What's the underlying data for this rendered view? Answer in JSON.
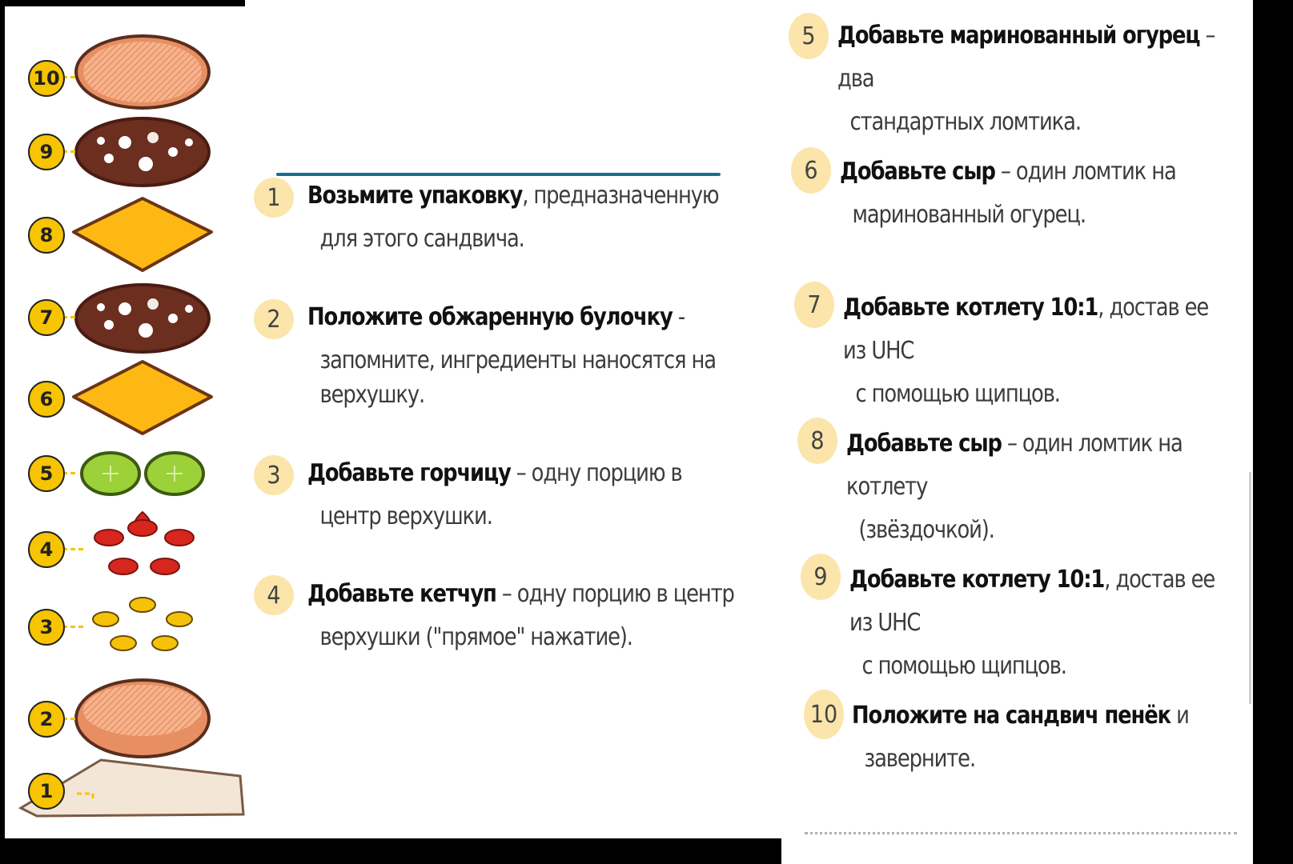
{
  "layers": [
    {
      "n": "10",
      "item": "bun-top"
    },
    {
      "n": "9",
      "item": "patty"
    },
    {
      "n": "8",
      "item": "cheese"
    },
    {
      "n": "7",
      "item": "patty"
    },
    {
      "n": "6",
      "item": "cheese"
    },
    {
      "n": "5",
      "item": "pickles"
    },
    {
      "n": "4",
      "item": "ketchup"
    },
    {
      "n": "3",
      "item": "mustard"
    },
    {
      "n": "2",
      "item": "bun-bottom"
    },
    {
      "n": "1",
      "item": "wrapper"
    }
  ],
  "steps": [
    {
      "num": "1",
      "bold": "Возьмите упаковку",
      "rest_first": ", предназначенную",
      "cont": [
        "для этого сандвича."
      ]
    },
    {
      "num": "2",
      "bold": "Положите обжаренную булочку",
      "rest_first": " -",
      "cont": [
        "запомните, ингредиенты наносятся на",
        "верхушку."
      ]
    },
    {
      "num": "3",
      "bold": "Добавьте горчицу",
      "rest_first": " – одну порцию в",
      "cont": [
        "центр верхушки."
      ]
    },
    {
      "num": "4",
      "bold": "Добавьте кетчуп",
      "rest_first": " – одну порцию в центр",
      "cont": [
        "верхушки (\"прямое\" нажатие)."
      ]
    },
    {
      "num": "5",
      "bold": "Добавьте маринованный огурец",
      "rest_first": " – два",
      "cont": [
        "стандартных ломтика."
      ]
    },
    {
      "num": "6",
      "bold": "Добавьте сыр",
      "rest_first": " – один ломтик на",
      "cont": [
        "маринованный огурец."
      ]
    },
    {
      "num": "7",
      "bold": "Добавьте котлету 10:1",
      "rest_first": ", достав ее из UHC",
      "cont": [
        "с помощью щипцов."
      ]
    },
    {
      "num": "8",
      "bold": "Добавьте сыр",
      "rest_first": " – один ломтик на котлету",
      "cont": [
        "(звёздочкой)."
      ]
    },
    {
      "num": "9",
      "bold": "Добавьте котлету 10:1",
      "rest_first": ", достав ее из UHC",
      "cont": [
        "с помощью щипцов."
      ]
    },
    {
      "num": "10",
      "bold": "Положите на сандвич пенёк",
      "rest_first": " и",
      "cont": [
        "заверните."
      ]
    }
  ],
  "colors": {
    "badge": "#f6c400",
    "step_circle": "#fbe5ab",
    "cheese": "#fdb813",
    "patty": "#6b2e1f",
    "bun": "#f4a97f",
    "pickle": "#9cd13a",
    "ketchup": "#d7261e",
    "mustard": "#f5c20a",
    "accent_line": "#1a6f8f"
  }
}
